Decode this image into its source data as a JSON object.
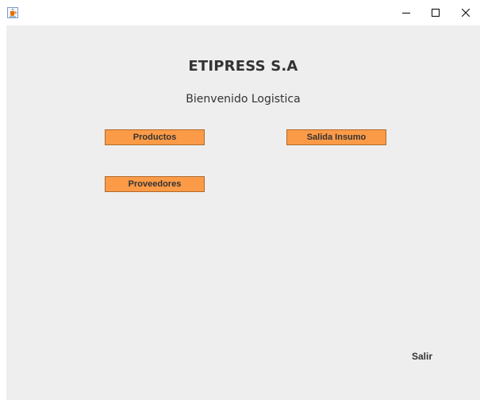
{
  "window": {
    "controls": {
      "minimize_icon": "minimize-icon",
      "maximize_icon": "maximize-icon",
      "close_icon": "close-icon"
    },
    "app_icon": "java-coffee-cup-icon"
  },
  "main": {
    "title": "ETIPRESS S.A",
    "subtitle": "Bienvenido Logistica",
    "buttons": {
      "productos": "Productos",
      "salida_insumo": "Salida Insumo",
      "proveedores": "Proveedores",
      "salir": "Salir"
    }
  },
  "colors": {
    "button_bg": "#fb9a47",
    "content_bg": "#eeeeee"
  }
}
